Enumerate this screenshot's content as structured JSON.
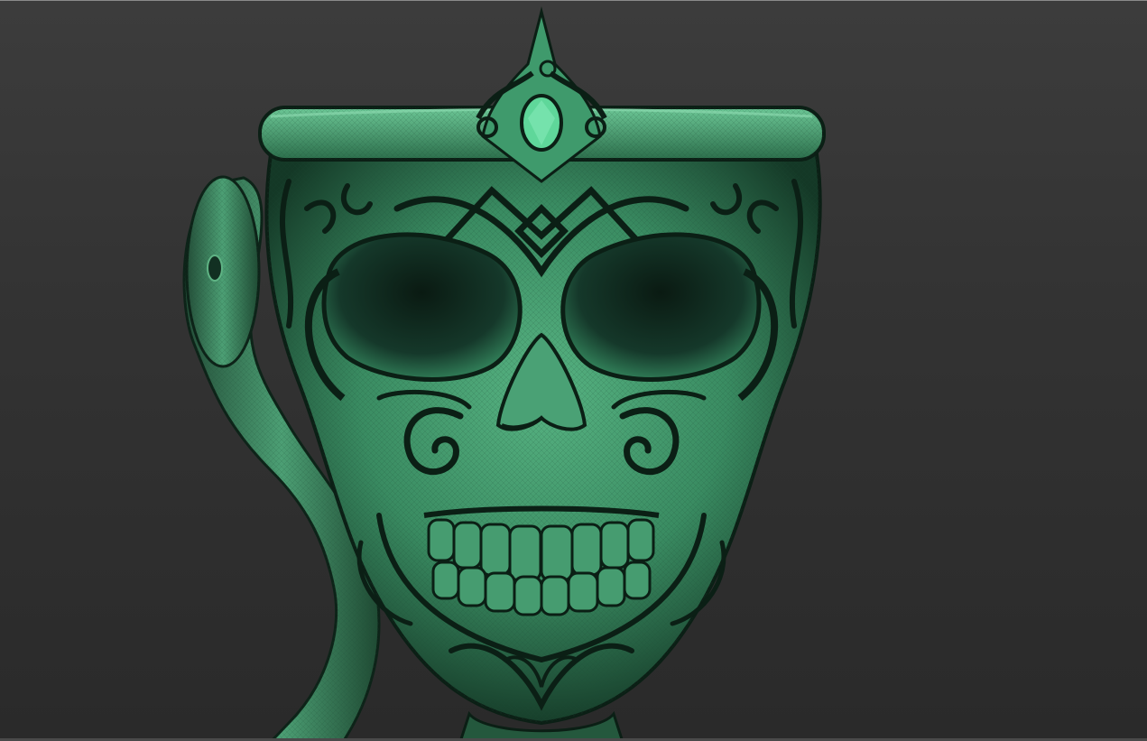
{
  "viewport": {
    "background_top": "#3c3c3c",
    "background_bottom": "#2a2a2a",
    "frame_line": "#8a8a8a"
  },
  "model": {
    "subject": "skull-mug-sculpt",
    "material_color": "#3f9a6c",
    "highlight_color": "#6cc796",
    "shadow_color": "#0b1f15",
    "gem_color": "#5fd79a"
  }
}
